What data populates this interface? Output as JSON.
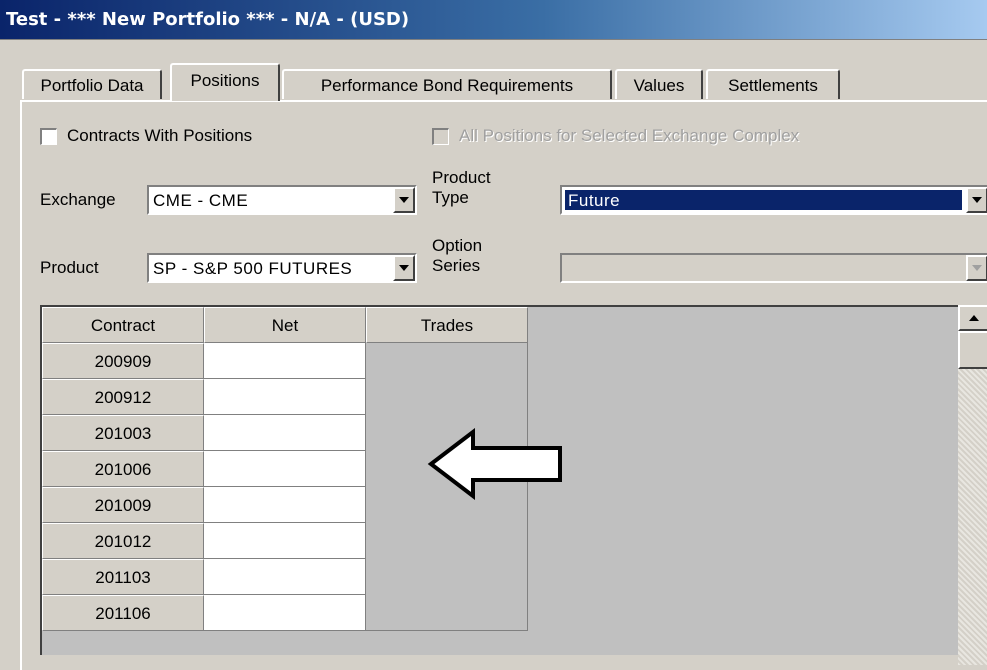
{
  "window": {
    "title": "Test - *** New Portfolio *** - N/A - (USD)"
  },
  "tabs": [
    {
      "label": "Portfolio Data"
    },
    {
      "label": "Positions"
    },
    {
      "label": "Performance Bond Requirements"
    },
    {
      "label": "Values"
    },
    {
      "label": "Settlements"
    }
  ],
  "filters": {
    "contracts_with_positions_label": "Contracts With Positions",
    "all_positions_label": "All Positions for Selected Exchange Complex",
    "exchange_label": "Exchange",
    "exchange_value": "CME - CME",
    "product_type_label": "Product\nType",
    "product_type_value": "Future",
    "product_label": "Product",
    "product_value": "SP -  S&P 500 FUTURES",
    "option_series_label": "Option\nSeries",
    "option_series_value": ""
  },
  "grid": {
    "columns": [
      "Contract",
      "Net",
      "Trades"
    ],
    "rows": [
      {
        "contract": "200909",
        "net": ""
      },
      {
        "contract": "200912",
        "net": ""
      },
      {
        "contract": "201003",
        "net": ""
      },
      {
        "contract": "201006",
        "net": ""
      },
      {
        "contract": "201009",
        "net": ""
      },
      {
        "contract": "201012",
        "net": ""
      },
      {
        "contract": "201103",
        "net": ""
      },
      {
        "contract": "201106",
        "net": ""
      }
    ]
  },
  "colors": {
    "selection": "#0a246a",
    "face": "#d4d0c8"
  },
  "icons": {
    "pointer": "left-arrow-icon"
  }
}
